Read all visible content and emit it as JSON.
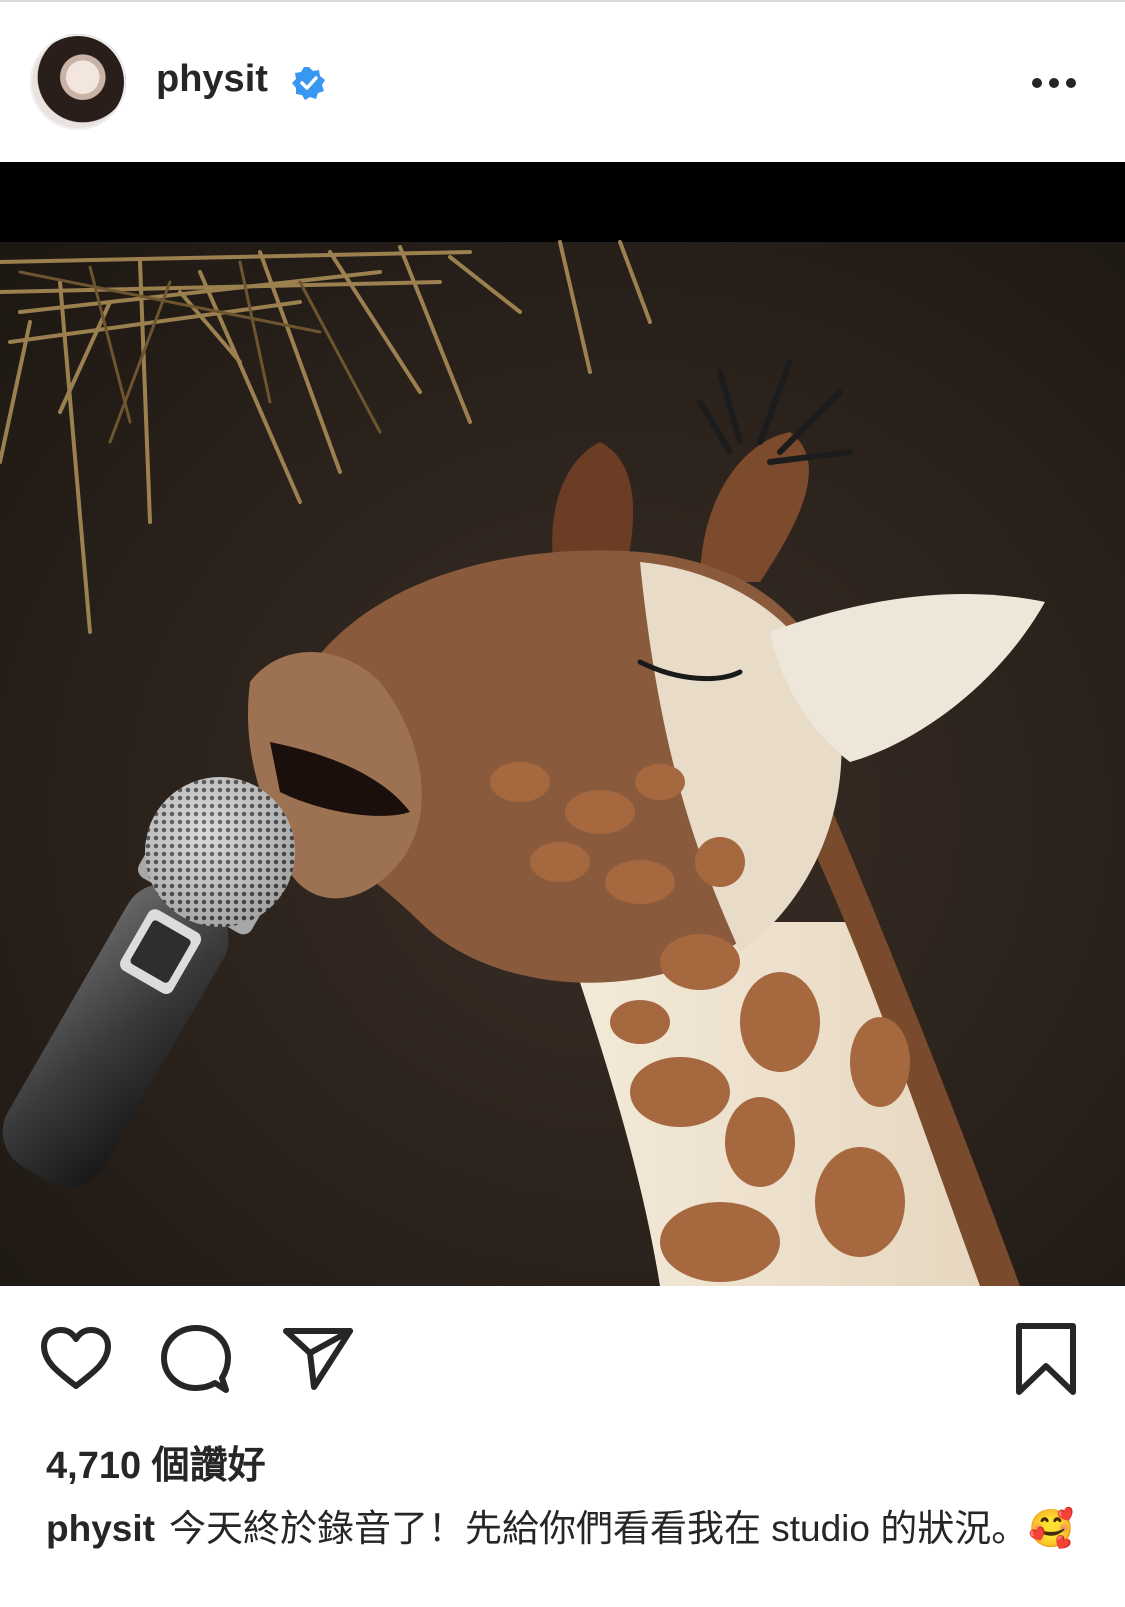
{
  "post": {
    "username": "physit",
    "verified": true,
    "likes": "4,710 個讚好",
    "caption": {
      "user": "physit",
      "text": "今天終於錄音了！先給你們看看我在 studio 的狀況。",
      "emoji": "🥰"
    }
  },
  "icons": {
    "avatar": "profile-avatar",
    "verified": "verified-badge-icon",
    "more": "more-options-icon",
    "like": "heart-icon",
    "comment": "comment-bubble-icon",
    "share": "paper-plane-icon",
    "save": "bookmark-icon"
  },
  "colors": {
    "text": "#262626",
    "verified": "#3897f0",
    "divider": "#dbdbdb",
    "photo_bg": "#000000"
  }
}
